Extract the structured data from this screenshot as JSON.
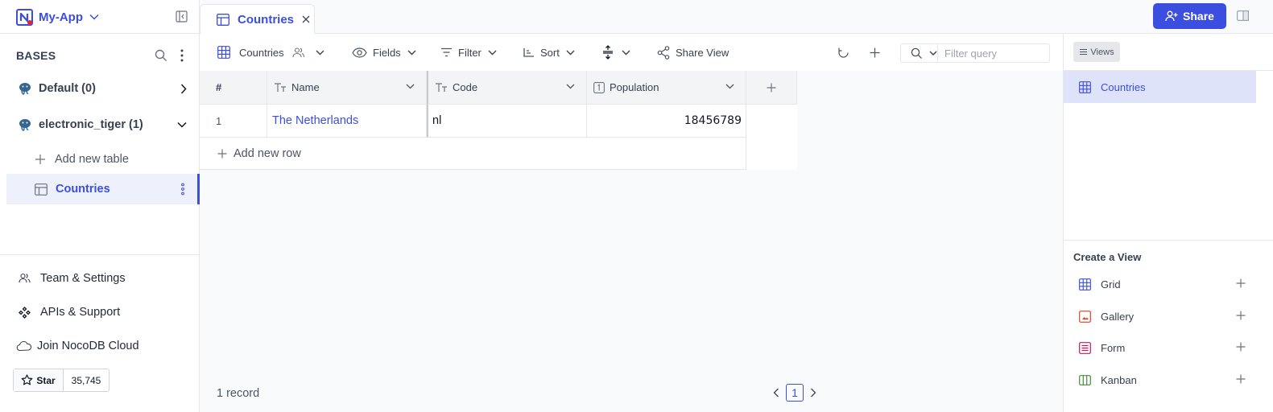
{
  "app": {
    "name": "My-App"
  },
  "sidebar": {
    "bases_heading": "BASES",
    "bases": [
      {
        "label": "Default (0)",
        "expanded": false
      },
      {
        "label": "electronic_tiger (1)",
        "expanded": true
      }
    ],
    "add_table_label": "Add new table",
    "active_table": "Countries",
    "footer": {
      "team_settings": "Team & Settings",
      "apis_support": "APIs & Support",
      "join_cloud": "Join NocoDB Cloud",
      "star_label": "Star",
      "star_count": "35,745"
    }
  },
  "tabs": [
    {
      "label": "Countries",
      "active": true
    }
  ],
  "share_button": "Share",
  "toolbar": {
    "view_name": "Countries",
    "fields": "Fields",
    "filter": "Filter",
    "sort": "Sort",
    "share_view": "Share View",
    "search_placeholder": "Filter query"
  },
  "grid": {
    "columns": [
      {
        "label": "#",
        "type": "index"
      },
      {
        "label": "Name",
        "type": "text"
      },
      {
        "label": "Code",
        "type": "text"
      },
      {
        "label": "Population",
        "type": "number"
      }
    ],
    "rows": [
      {
        "index": "1",
        "name": "The Netherlands",
        "code": "nl",
        "population": "18456789"
      }
    ],
    "add_row_label": "Add new row",
    "record_count": "1 record",
    "page": "1"
  },
  "views_panel": {
    "chip_label": "Views",
    "views": [
      {
        "label": "Countries"
      }
    ],
    "create_heading": "Create a View",
    "create_options": [
      {
        "label": "Grid",
        "color": "#3b4ee0"
      },
      {
        "label": "Gallery",
        "color": "#d6452b"
      },
      {
        "label": "Form",
        "color": "#c2185b"
      },
      {
        "label": "Kanban",
        "color": "#4a8a3a"
      }
    ]
  },
  "colors": {
    "accent": "#3b4ee0",
    "active_bg": "#dfe3fa"
  }
}
